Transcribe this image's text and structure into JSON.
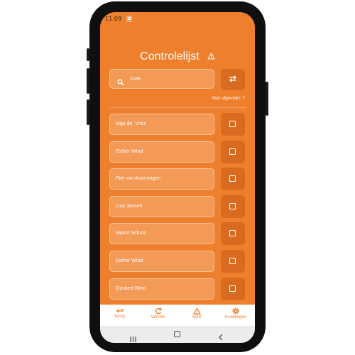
{
  "status_bar": {
    "time": "11:09"
  },
  "header": {
    "title": "Controlelijst"
  },
  "search": {
    "placeholder": "Zoek"
  },
  "filter": {
    "label": "Niet afgevinkt: 7"
  },
  "people": [
    {
      "name": "Inge de  Vries",
      "checked": false
    },
    {
      "name": "Esther Wind",
      "checked": false
    },
    {
      "name": "Piet van Amerongen",
      "checked": false
    },
    {
      "name": "Lisa Jansen",
      "checked": false
    },
    {
      "name": "Marco Schutz",
      "checked": false
    },
    {
      "name": "Esther Wind",
      "checked": false
    },
    {
      "name": "Gysbert Wind",
      "checked": false
    }
  ],
  "bottom_nav": [
    {
      "label": "Terug",
      "icon": "back-arrow-icon"
    },
    {
      "label": "Ververs",
      "icon": "refresh-icon"
    },
    {
      "label": "SOS",
      "icon": "warning-icon"
    },
    {
      "label": "Instellingen",
      "icon": "gear-icon"
    }
  ],
  "colors": {
    "accent": "#ee7f2d",
    "accent_dark": "#d86b1f",
    "field": "#f29a56"
  }
}
